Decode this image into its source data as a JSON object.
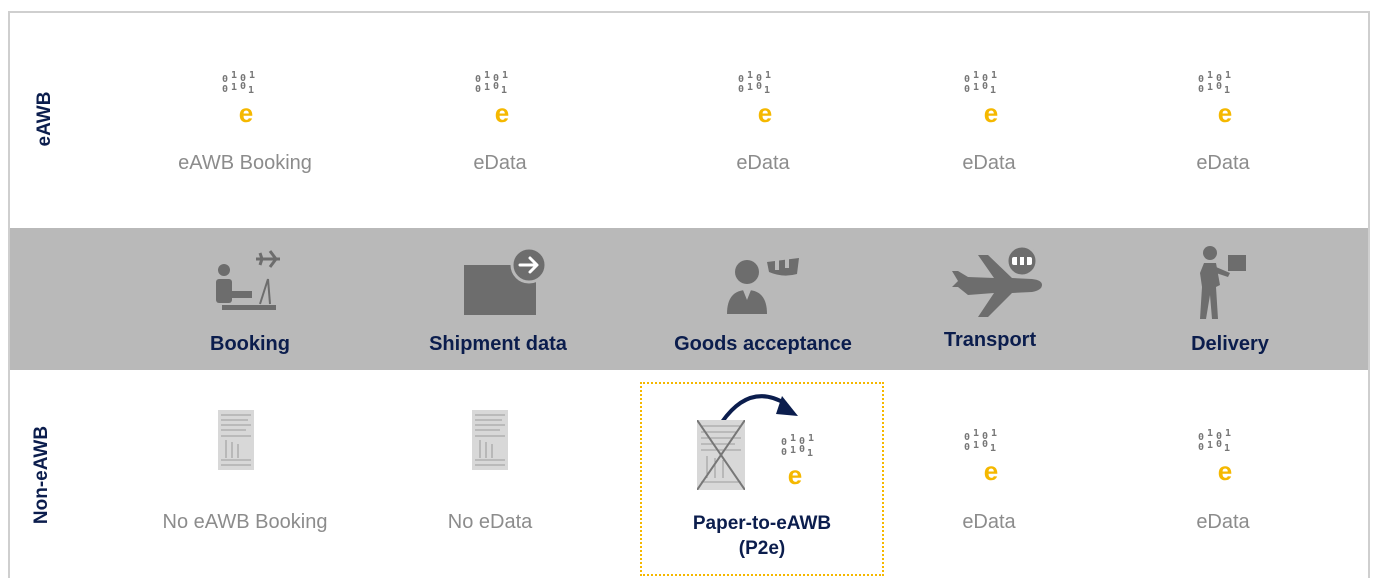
{
  "rows": {
    "top_label": "eAWB",
    "bottom_label": "Non-eAWB"
  },
  "bits_glyphs": [
    "0",
    "1",
    "0",
    "1",
    "0",
    "1",
    "0",
    "1"
  ],
  "e_glyph": "e",
  "eawb_row": [
    {
      "caption": "eAWB Booking"
    },
    {
      "caption": "eData"
    },
    {
      "caption": "eData"
    },
    {
      "caption": "eData"
    },
    {
      "caption": "eData"
    }
  ],
  "stages": [
    {
      "label": "Booking",
      "icon": "person-at-computer-icon"
    },
    {
      "label": "Shipment data",
      "icon": "document-send-icon"
    },
    {
      "label": "Goods acceptance",
      "icon": "agent-with-scanner-icon"
    },
    {
      "label": "Transport",
      "icon": "airplane-icon"
    },
    {
      "label": "Delivery",
      "icon": "courier-with-parcel-icon"
    }
  ],
  "non_eawb_row": [
    {
      "caption": "No eAWB Booking",
      "type": "paper"
    },
    {
      "caption": "No eData",
      "type": "paper"
    },
    {
      "caption_line1": "Paper-to-eAWB",
      "caption_line2": "(P2e)",
      "type": "conversion"
    },
    {
      "caption": "eData",
      "type": "edata"
    },
    {
      "caption": "eData",
      "type": "edata"
    }
  ],
  "colors": {
    "accent_yellow": "#f5b800",
    "navy": "#0b1d4d",
    "band_gray": "#b9b9b9",
    "icon_gray": "#6d6d6d",
    "caption_gray": "#8c8c8c"
  }
}
